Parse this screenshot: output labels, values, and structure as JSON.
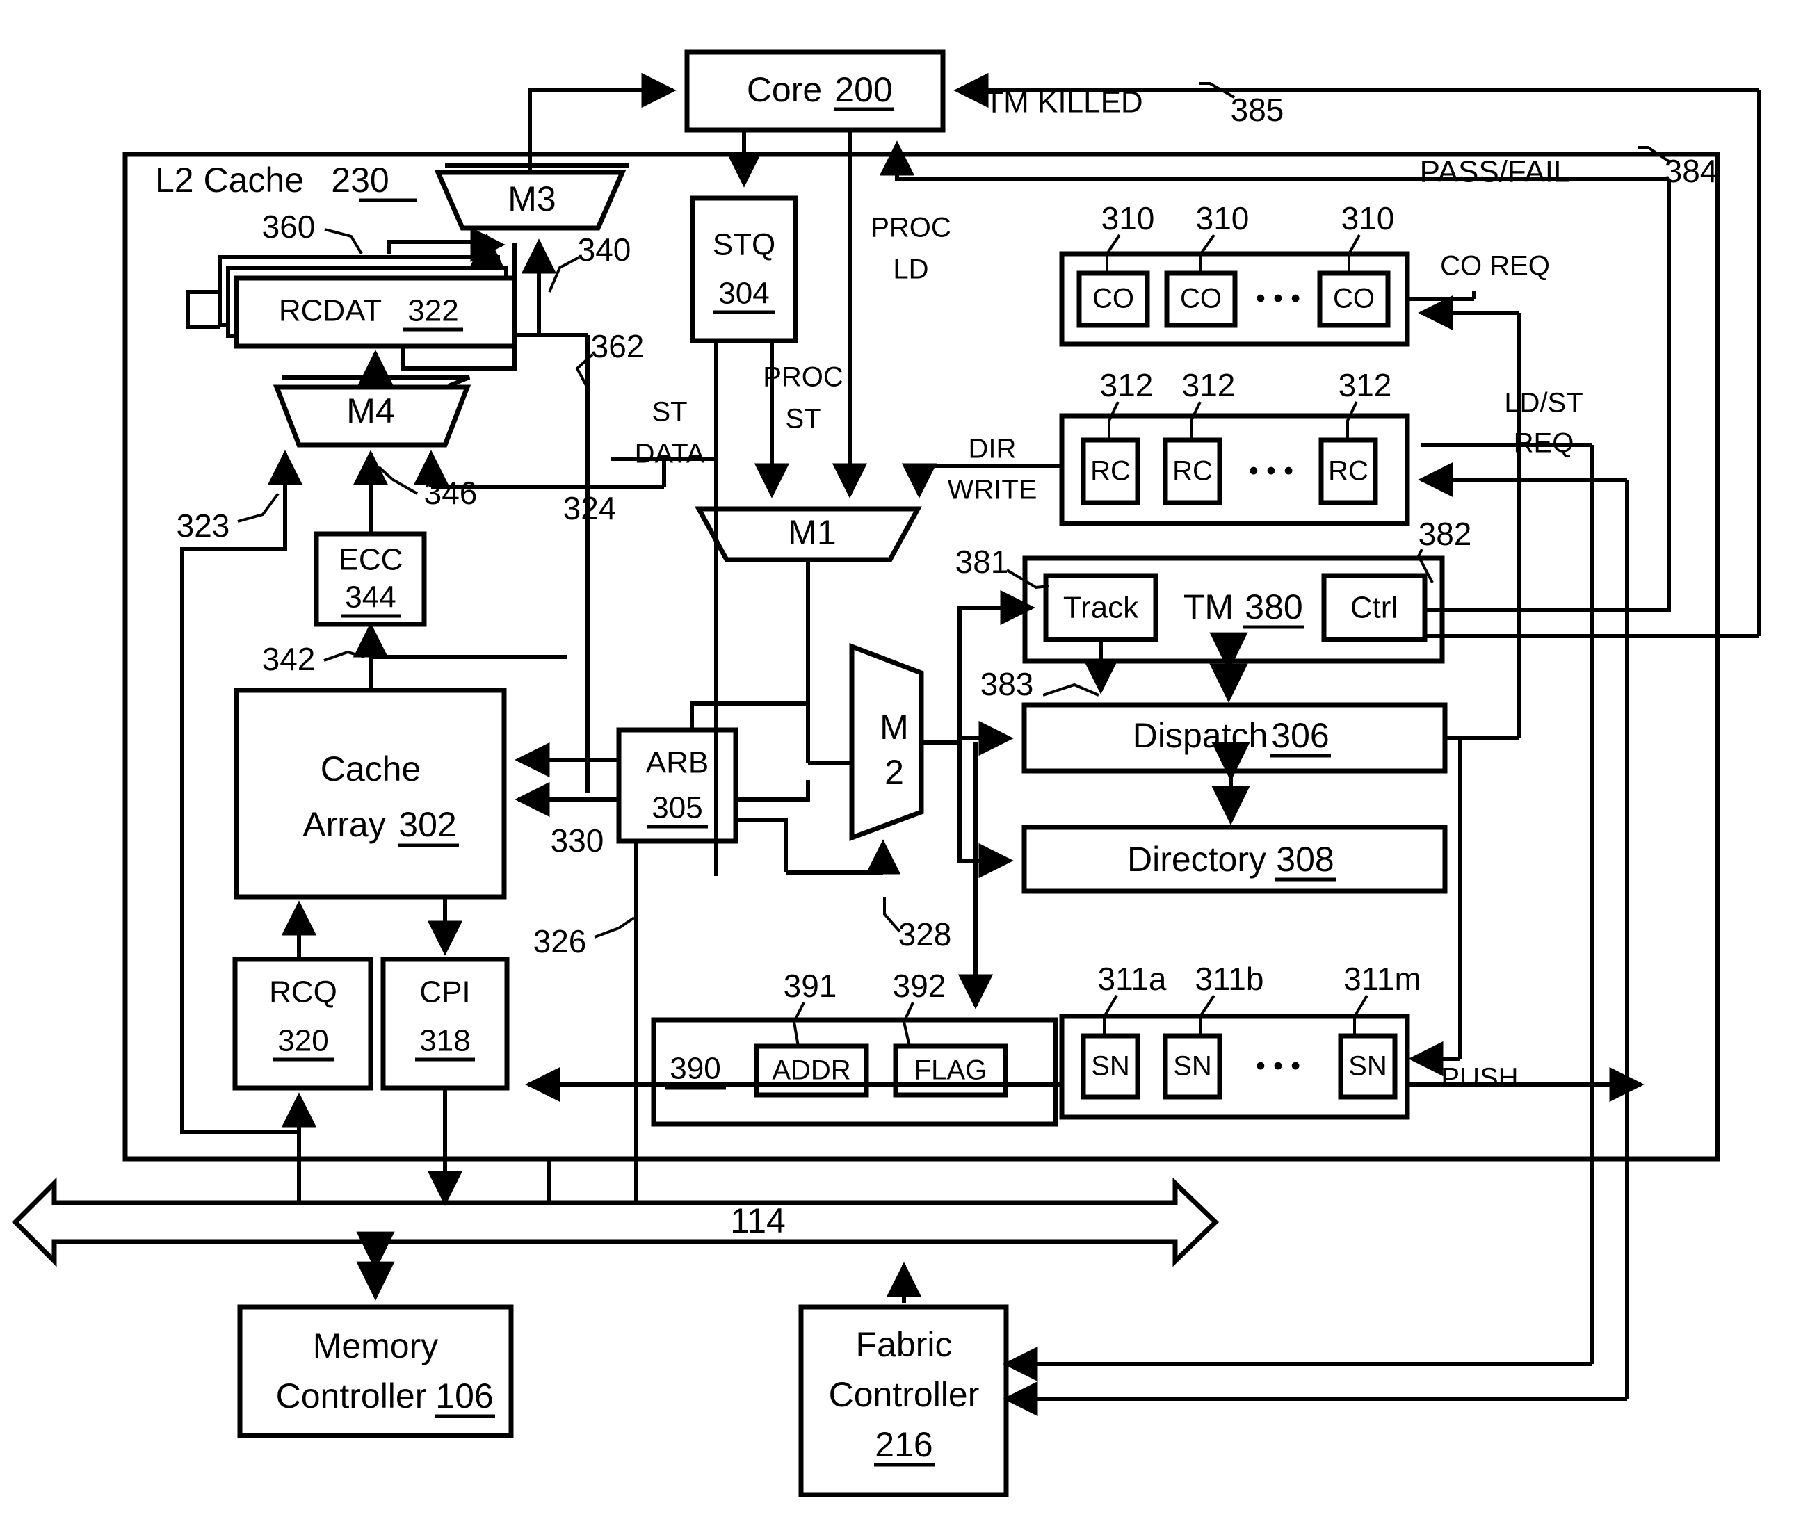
{
  "figure": {
    "type": "patent-block-diagram",
    "title_block": "L2 Cache 230"
  },
  "blocks": {
    "core": {
      "label": "Core",
      "ref": "200"
    },
    "l2cache": {
      "label": "L2 Cache",
      "ref": "230"
    },
    "m3": {
      "label": "M3"
    },
    "m4": {
      "label": "M4"
    },
    "m1": {
      "label": "M1"
    },
    "m2": {
      "label": "M 2",
      "line1": "M",
      "line2": "2"
    },
    "rcdat": {
      "label": "RCDAT",
      "ref": "322"
    },
    "ecc": {
      "label": "ECC",
      "ref": "344"
    },
    "cache_array": {
      "line1": "Cache",
      "line2": "Array",
      "ref": "302"
    },
    "rcq": {
      "label": "RCQ",
      "ref": "320"
    },
    "cpi": {
      "label": "CPI",
      "ref": "318"
    },
    "stq": {
      "label": "STQ",
      "ref": "304"
    },
    "arb": {
      "label": "ARB",
      "ref": "305"
    },
    "tm": {
      "label": "TM",
      "ref": "380",
      "track": "Track",
      "ctrl": "Ctrl"
    },
    "dispatch": {
      "label": "Dispatch",
      "ref": "306"
    },
    "directory": {
      "label": "Directory",
      "ref": "308"
    },
    "co_group": {
      "items": [
        "CO",
        "CO",
        "CO"
      ],
      "ellipsis": "• • •"
    },
    "rc_group": {
      "items": [
        "RC",
        "RC",
        "RC"
      ],
      "ellipsis": "• • •"
    },
    "sn_group": {
      "items": [
        "SN",
        "SN",
        "SN"
      ],
      "ellipsis": "• • •"
    },
    "reg390": {
      "ref": "390",
      "addr": "ADDR",
      "flag": "FLAG"
    },
    "bus": {
      "ref": "114"
    },
    "memory_controller": {
      "line1": "Memory",
      "line2": "Controller",
      "ref": "106"
    },
    "fabric_controller": {
      "line1": "Fabric",
      "line2": "Controller",
      "ref": "216"
    }
  },
  "signal_labels": {
    "tm_killed": "TM KILLED",
    "pass_fail": "PASS/FAIL",
    "proc_ld_1": "PROC",
    "proc_ld_2": "LD",
    "proc_st_1": "PROC",
    "proc_st_2": "ST",
    "st_data_1": "ST",
    "st_data_2": "DATA",
    "dir_write_1": "DIR",
    "dir_write_2": "WRITE",
    "co_req": "CO REQ",
    "ldst_req_1": "LD/ST",
    "ldst_req_2": "REQ",
    "push": "PUSH"
  },
  "ref_numerals": {
    "n360": "360",
    "n340": "340",
    "n362": "362",
    "n323": "323",
    "n346": "346",
    "n342": "342",
    "n324": "324",
    "n326": "326",
    "n328": "328",
    "n330": "330",
    "n381": "381",
    "n382": "382",
    "n383": "383",
    "n384": "384",
    "n385": "385",
    "n391": "391",
    "n392": "392",
    "n310a": "310",
    "n310b": "310",
    "n310c": "310",
    "n312a": "312",
    "n312b": "312",
    "n312c": "312",
    "n311a": "311a",
    "n311b": "311b",
    "n311m": "311m"
  },
  "colors": {
    "ink": "#000000",
    "paper": "#ffffff"
  }
}
